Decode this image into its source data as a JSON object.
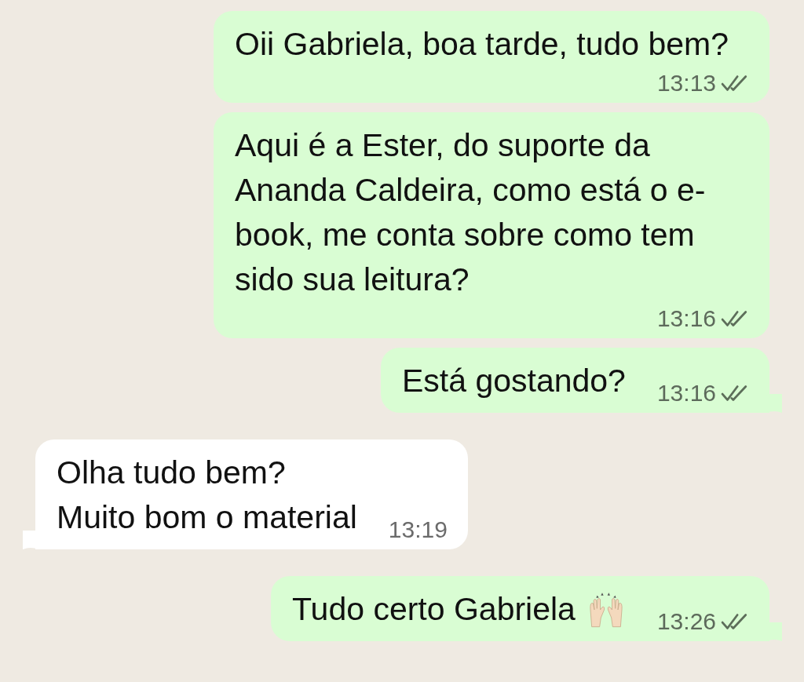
{
  "messages": [
    {
      "outgoing": true,
      "text": "Oii Gabriela, boa tarde, tudo bem?",
      "time": "13:13",
      "read": false,
      "tail": false
    },
    {
      "outgoing": true,
      "text": "Aqui é a Ester, do suporte da Ananda Caldeira, como está o e-book, me conta sobre como tem sido sua leitura?",
      "time": "13:16",
      "read": false,
      "tail": false
    },
    {
      "outgoing": true,
      "text": "Está gostando?",
      "time": "13:16",
      "read": false,
      "tail": true
    },
    {
      "outgoing": false,
      "text": "Olha tudo bem?\nMuito bom o material",
      "time": "13:19",
      "tail": true
    },
    {
      "outgoing": true,
      "text": "Tudo certo Gabriela",
      "raised_hands": true,
      "time": "13:26",
      "read": false,
      "tail": true
    }
  ]
}
